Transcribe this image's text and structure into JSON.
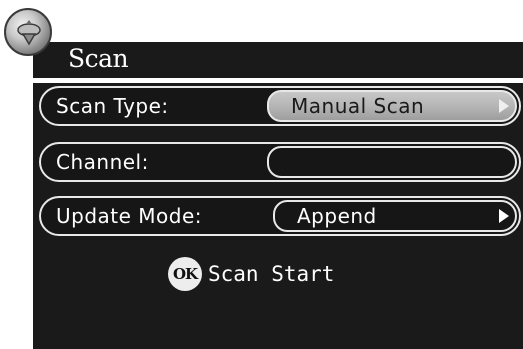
{
  "menu": {
    "title": "Scan",
    "icon": "dish-antenna-icon"
  },
  "rows": [
    {
      "label": "Scan Type:",
      "value": "Manual Scan",
      "selected": true,
      "has_arrow": true
    },
    {
      "label": "Channel:",
      "value": "",
      "selected": false,
      "has_arrow": false
    },
    {
      "label": "Update Mode:",
      "value": "Append",
      "selected": false,
      "has_arrow": true
    }
  ],
  "action": {
    "key_label": "OK",
    "label": "Scan Start"
  },
  "colors": {
    "panel_background": "#1a1a1a",
    "highlight": "#b3b3b3",
    "text": "#ffffff",
    "border": "#e8e8e8"
  }
}
